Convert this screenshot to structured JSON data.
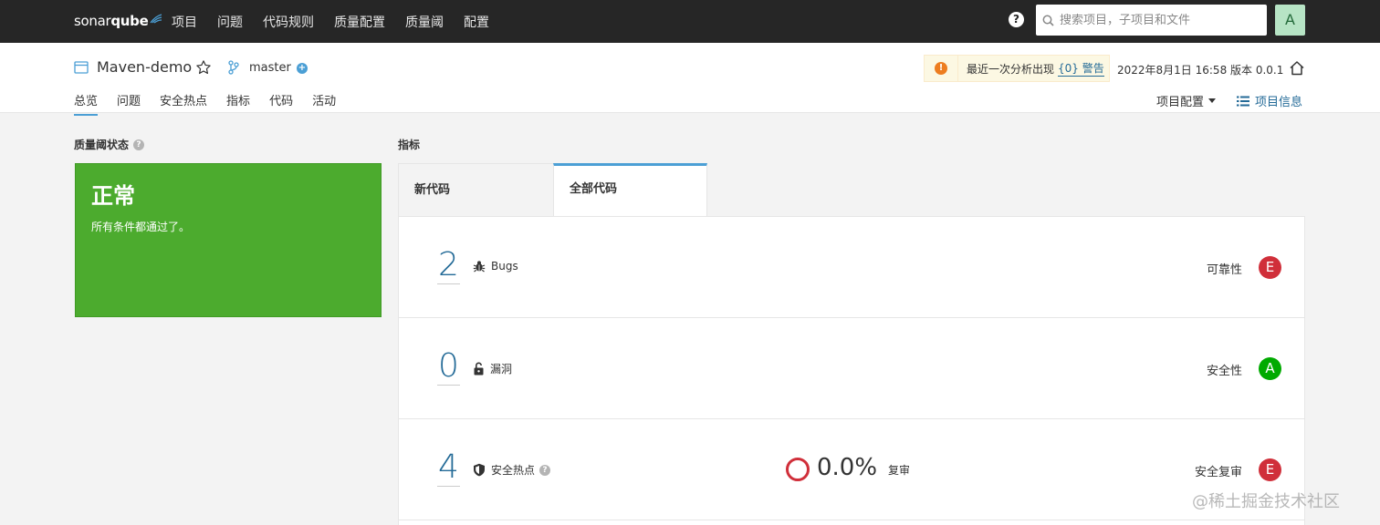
{
  "topnav": {
    "logo_regular": "sonar",
    "logo_bold": "qube",
    "items": [
      "项目",
      "问题",
      "代码规则",
      "质量配置",
      "质量阈",
      "配置"
    ],
    "help_icon": "question-circle-icon",
    "search_placeholder": "搜索项目，子项目和文件",
    "avatar_letter": "A"
  },
  "project": {
    "name": "Maven-demo",
    "branch": "master",
    "tabs": [
      "总览",
      "问题",
      "安全热点",
      "指标",
      "代码",
      "活动"
    ],
    "active_tab": "总览",
    "warning_text": "最近一次分析出现",
    "warning_link": "{0} 警告",
    "analysis_date": "2022年8月1日 16:58",
    "version": "版本 0.0.1",
    "config_label": "项目配置",
    "info_label": "项目信息"
  },
  "quality_gate": {
    "title": "质量阈状态",
    "status": "正常",
    "message": "所有条件都通过了。",
    "color": "#4cab2e"
  },
  "metrics": {
    "title": "指标",
    "tab_new": "新代码",
    "tab_all": "全部代码",
    "rows": [
      {
        "value": "2",
        "label": "Bugs",
        "icon": "bug-icon",
        "rating_label": "可靠性",
        "rating": "E",
        "rating_color": "#d02f3a"
      },
      {
        "value": "0",
        "label": "漏洞",
        "icon": "lock-icon",
        "rating_label": "安全性",
        "rating": "A",
        "rating_color": "#00aa00"
      },
      {
        "value": "4",
        "label": "安全热点",
        "icon": "shield-icon",
        "review_value": "0.0%",
        "review_label": "复审",
        "rating_label": "安全复审",
        "rating": "E",
        "rating_color": "#d02f3a"
      }
    ]
  },
  "watermark": "@稀土掘金技术社区"
}
